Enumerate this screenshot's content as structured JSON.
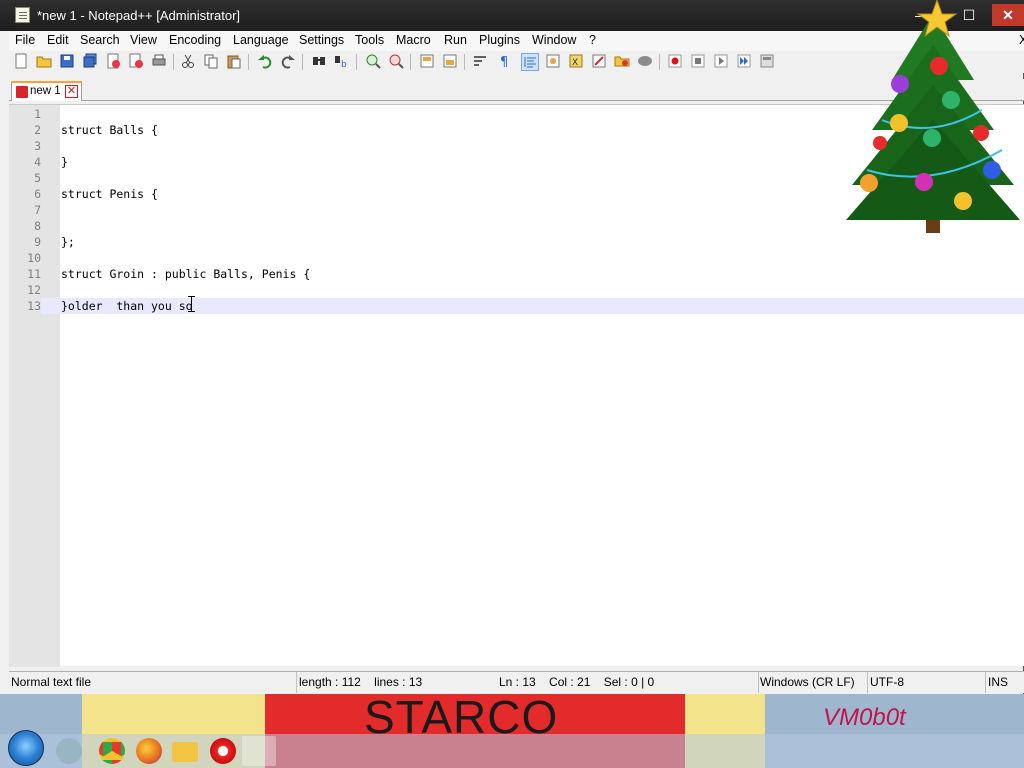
{
  "window": {
    "title": "*new 1 - Notepad++ [Administrator]",
    "min_glyph": "—",
    "max_glyph": "☐",
    "close_glyph": "✕"
  },
  "menu": [
    "File",
    "Edit",
    "Search",
    "View",
    "Encoding",
    "Language",
    "Settings",
    "Tools",
    "Macro",
    "Run",
    "Plugins",
    "Window",
    "?"
  ],
  "menu_close": "X",
  "toolbar_icons": [
    "new-file-icon",
    "open-file-icon",
    "save-icon",
    "save-all-icon",
    "close-icon",
    "close-all-icon",
    "print-icon",
    "cut-icon",
    "copy-icon",
    "paste-icon",
    "undo-icon",
    "redo-icon",
    "find-icon",
    "replace-icon",
    "zoom-in-icon",
    "zoom-out-icon",
    "sync-vertical-icon",
    "sync-horizontal-icon",
    "word-wrap-icon",
    "show-all-characters-icon",
    "indent-guide-icon",
    "user-language-icon",
    "function-list-icon",
    "document-map-icon",
    "folder-as-workspace-icon",
    "monitoring-icon",
    "record-macro-icon",
    "stop-macro-icon",
    "play-macro-icon",
    "run-macro-multiple-icon",
    "save-macro-icon"
  ],
  "tab": {
    "label": "new 1",
    "close_glyph": "✕"
  },
  "editor": {
    "lines": [
      {
        "n": "1",
        "text": ""
      },
      {
        "n": "2",
        "text": "struct Balls {"
      },
      {
        "n": "3",
        "text": ""
      },
      {
        "n": "4",
        "text": "}"
      },
      {
        "n": "5",
        "text": ""
      },
      {
        "n": "6",
        "text": "struct Penis {"
      },
      {
        "n": "7",
        "text": ""
      },
      {
        "n": "8",
        "text": ""
      },
      {
        "n": "9",
        "text": "};"
      },
      {
        "n": "10",
        "text": ""
      },
      {
        "n": "11",
        "text": "struct Groin : public Balls, Penis {"
      },
      {
        "n": "12",
        "text": ""
      },
      {
        "n": "13",
        "text": "}older  than you so"
      }
    ],
    "current_line": 13
  },
  "status": {
    "file_type": "Normal text file",
    "length": "length : 112",
    "lines": "lines : 13",
    "ln": "Ln : 13",
    "col": "Col : 21",
    "sel": "Sel : 0 | 0",
    "eol": "Windows (CR LF)",
    "encoding": "UTF-8",
    "mode": "INS"
  },
  "desktop": {
    "wallpaper_text": "STARCO",
    "wallpaper_signature": "VM0b0t"
  },
  "taskbar_icons": [
    "start-orb-icon",
    "ie-icon",
    "chrome-icon",
    "firefox-icon",
    "explorer-icon",
    "opera-icon",
    "notepadpp-icon"
  ],
  "colors": {
    "title_bar": "#1e1e1e",
    "current_line_highlight": "#e8e8ff",
    "gutter": "#e4e4e4",
    "tab_accent": "#f9a23b"
  }
}
